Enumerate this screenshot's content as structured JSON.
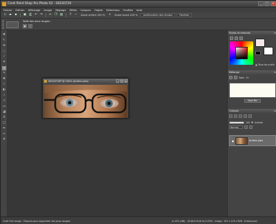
{
  "window": {
    "title": "Corel Paint Shop Pro Photo X2 - 00220720"
  },
  "menu": [
    "Fichier",
    "Edition",
    "Affichage",
    "Image",
    "Réglage",
    "Effets",
    "Calques",
    "Objets",
    "Sélections",
    "Fenêtre",
    "Aide"
  ],
  "toolbar": {
    "zoom_out_label": "Zoom arrière 100 %",
    "zoom_in_label": "Zoom avant 100 %",
    "enhance_label": "Amélioration des photos",
    "palettes_label": "Palettes"
  },
  "options": {
    "label": "Taille des yeux rouges :"
  },
  "image_window": {
    "title": "00220720P @ 100% (Arrière-plan)"
  },
  "panels": {
    "materials": {
      "title": "Styles et textures",
      "all_tools": "Tous les outils"
    },
    "mixer": {
      "title": "Mélange",
      "size_label": "Taille",
      "size_value": "15",
      "save_button": "Save Mix"
    },
    "layers": {
      "title": "Calques",
      "opacity_value": "100",
      "auto_label": "Activée",
      "blend_mode": "Normal",
      "layer_name": "Arrière-plan"
    }
  },
  "status": {
    "left": "Outil Oeil rouge : Cliquez pour supprimer les yeux rouges.",
    "right": "(x:103 y:88) - (R:48,V:33,B:10,O:255) - Image : 347 x 135 x RVB - 8 bits/canal"
  },
  "colors": {
    "accent": "#d8a030",
    "workspace": "#373737"
  }
}
